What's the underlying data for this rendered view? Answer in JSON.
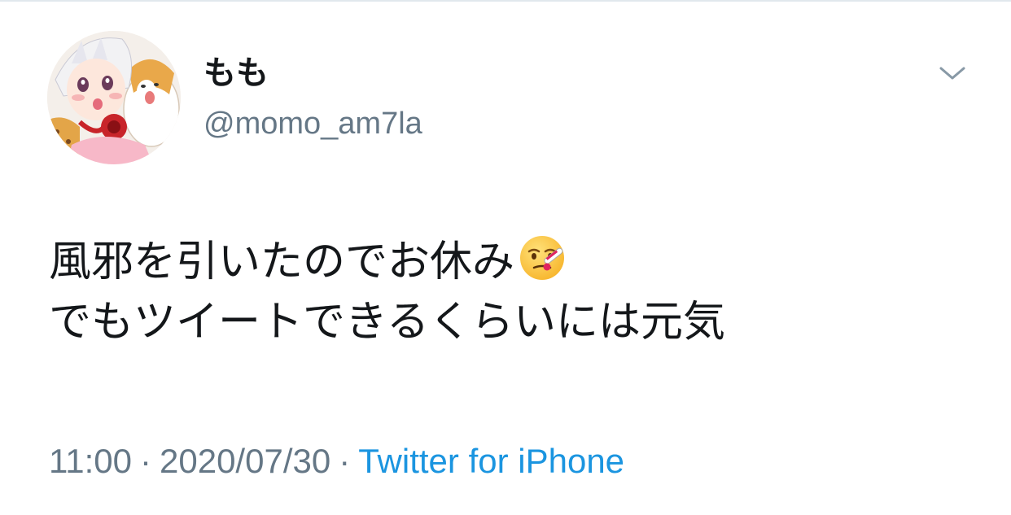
{
  "tweet": {
    "author": {
      "display_name": "もも",
      "handle": "@momo_am7la"
    },
    "text_lines": [
      "風邪を引いたのでお休み",
      "でもツイートできるくらいには元気"
    ],
    "emoji": "face-with-thermometer",
    "time": "11:00",
    "separator": "·",
    "date": "2020/07/30",
    "source": "Twitter for iPhone"
  },
  "colors": {
    "text": "#14171a",
    "secondary": "#657786",
    "link": "#1b95e0",
    "divider": "#e1e8ed"
  },
  "icons": {
    "more": "chevron-down-icon",
    "emoji": "face-with-thermometer-icon"
  }
}
